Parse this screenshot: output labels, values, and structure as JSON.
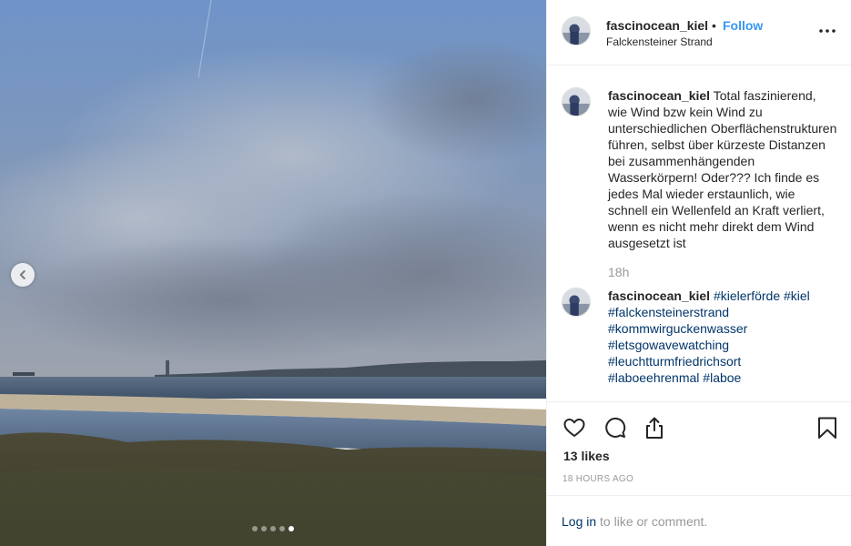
{
  "post": {
    "username": "fascinocean_kiel",
    "separator": "•",
    "follow_label": "Follow",
    "location": "Falckensteiner Strand",
    "carousel": {
      "count": 5,
      "active_index": 4
    }
  },
  "caption": {
    "author": "fascinocean_kiel",
    "text": "Total faszinierend, wie Wind bzw kein Wind zu unterschiedlichen Oberflächenstrukturen führen, selbst über kürzeste Distanzen bei zusammenhängenden Wasserkörpern! Oder??? Ich finde es jedes Mal wieder erstaunlich, wie schnell ein Wellenfeld an Kraft verliert, wenn es nicht mehr direkt dem Wind ausgesetzt ist",
    "time": "18h"
  },
  "comment": {
    "author": "fascinocean_kiel",
    "hashtags": [
      "#kielerförde",
      "#kiel",
      "#falckensteinerstrand",
      "#kommwirguckenwasser",
      "#letsgowavewatching",
      "#leuchtturmfriedrichsort",
      "#laboeehrenmal",
      "#laboe"
    ]
  },
  "engagement": {
    "likes": "13 likes",
    "timestamp": "18 HOURS AGO",
    "login_link": "Log in",
    "login_suffix": " to like or comment."
  },
  "icons": {
    "prev": "chevron-left-icon",
    "more": "more-options-icon",
    "like": "heart-icon",
    "comment": "comment-icon",
    "share": "share-icon",
    "save": "bookmark-icon"
  },
  "colors": {
    "link": "#3897f0",
    "hashtag": "#003569",
    "muted": "#999999",
    "text": "#262626"
  }
}
